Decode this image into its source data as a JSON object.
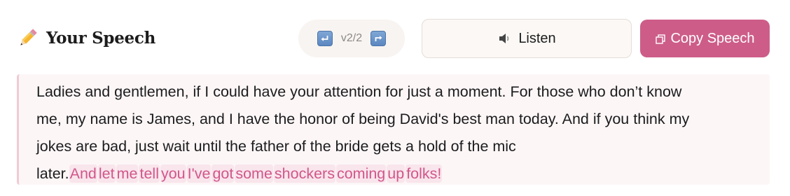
{
  "header": {
    "icon": "pencil-icon",
    "title": "Your Speech"
  },
  "version": {
    "label": "v2/2",
    "undo_icon": "undo-icon",
    "redo_icon": "redo-icon"
  },
  "listen_button": {
    "icon": "speaker-icon",
    "label": "Listen"
  },
  "copy_button": {
    "icon": "copy-icon",
    "label": "Copy Speech"
  },
  "speech": {
    "lines": [
      "Ladies and gentlemen, if I could have your attention for just a moment. For those who don’t know",
      "me, my name is James, and I have the honor of being David's best man today. And if you think my",
      "jokes are bad, just wait until the father of the bride gets a hold of the mic",
      "later."
    ],
    "highlighted_words": [
      "And",
      "let",
      "me",
      "tell",
      "you",
      "I've",
      "got",
      "some",
      "shockers",
      "coming",
      "up",
      "folks!"
    ]
  },
  "colors": {
    "accent": "#cd5d88",
    "highlight_bg": "#f9e5ec",
    "highlight_text": "#d1568a",
    "speech_bg": "#fcf6f7"
  }
}
